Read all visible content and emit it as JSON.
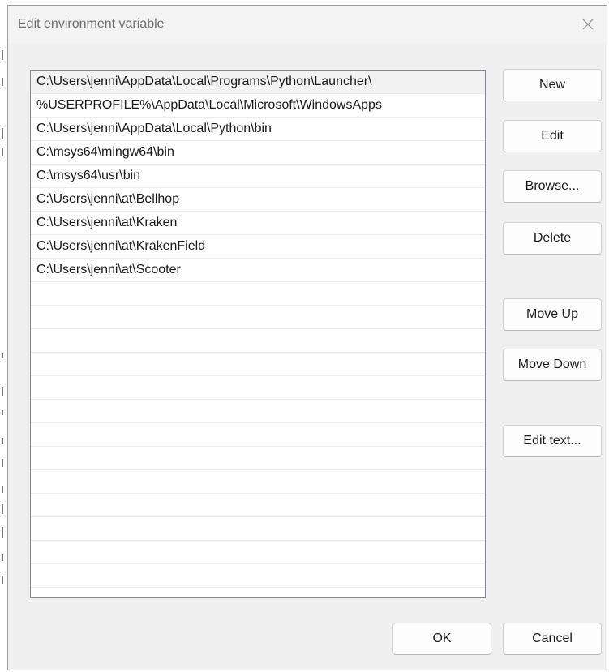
{
  "dialog": {
    "title": "Edit environment variable"
  },
  "paths": [
    "C:\\Users\\jenni\\AppData\\Local\\Programs\\Python\\Launcher\\",
    "%USERPROFILE%\\AppData\\Local\\Microsoft\\WindowsApps",
    "C:\\Users\\jenni\\AppData\\Local\\Python\\bin",
    "C:\\msys64\\mingw64\\bin",
    "C:\\msys64\\usr\\bin",
    "C:\\Users\\jenni\\at\\Bellhop",
    "C:\\Users\\jenni\\at\\Kraken",
    "C:\\Users\\jenni\\at\\KrakenField",
    "C:\\Users\\jenni\\at\\Scooter"
  ],
  "side_buttons": {
    "new_label": "New",
    "edit_label": "Edit",
    "browse_label": "Browse...",
    "delete_label": "Delete",
    "move_up_label": "Move Up",
    "move_down_label": "Move Down",
    "edit_text_label": "Edit text..."
  },
  "footer": {
    "ok_label": "OK",
    "cancel_label": "Cancel"
  },
  "icons": {
    "close": "close-icon"
  }
}
